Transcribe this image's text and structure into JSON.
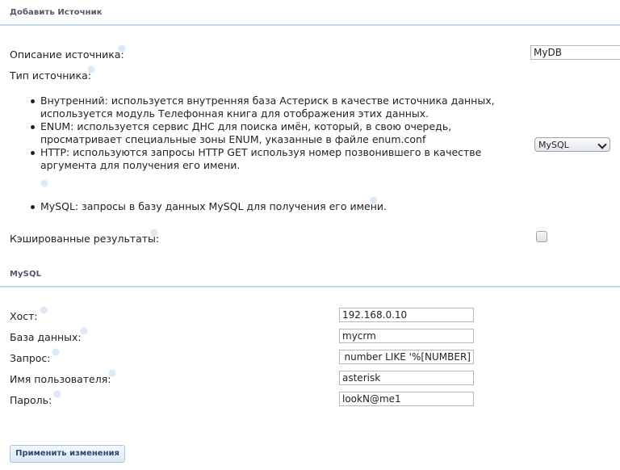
{
  "section_add": {
    "title": "Добавить Источник"
  },
  "fields": {
    "description_label": "Описание источника:",
    "description_value": "MyDB",
    "type_label": "Тип источника:",
    "type_options": [
      "Внутренний: используется внутренняя база Астериск в качестве источника данных, используется модуль Телефонная книга для отображения этих данных.",
      "ENUM: используется сервис ДНС для поиска имён, который, в свою очередь, просматривает специальные зоны ENUM, указанные в файле enum.conf",
      "HTTP: используются запросы HTTP GET используя номер позвонившего в качестве аргумента для получения его имени.",
      "MySQL: запросы в базу данных MySQL для получения его имени."
    ],
    "type_selected": "MySQL",
    "cache_label": "Кэшированные результаты:",
    "cache_checked": false
  },
  "section_mysql": {
    "title": "MySQL",
    "host_label": "Хост:",
    "host_value": "192.168.0.10",
    "db_label": "База данных:",
    "db_value": "mycrm",
    "query_label": "Запрос:",
    "query_value": "E number LIKE '%[NUMBER]'",
    "user_label": "Имя пользователя:",
    "user_value": "asterisk",
    "password_label": "Пароль:",
    "password_value": "lookN@me1"
  },
  "actions": {
    "apply_label": "Применить изменения"
  },
  "colors": {
    "rule": "#c8d9ea",
    "button_text": "#2a4a73",
    "help_dot": "#dbe8f6"
  }
}
